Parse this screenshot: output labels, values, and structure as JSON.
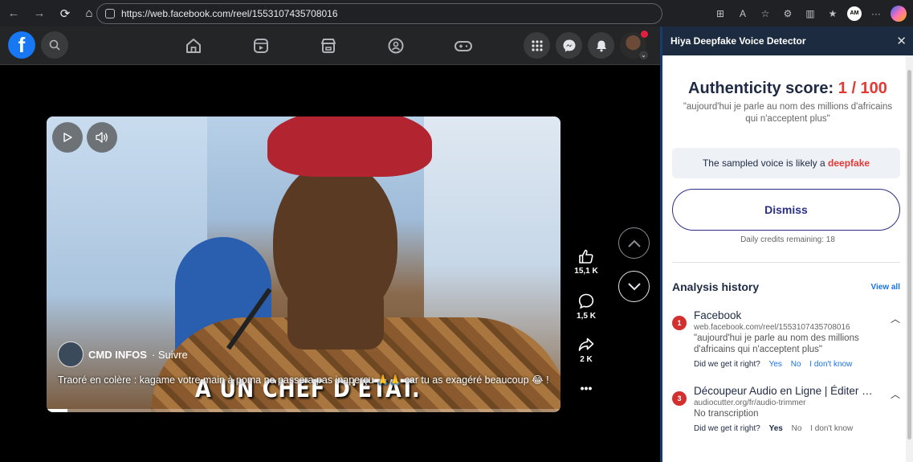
{
  "browser": {
    "url": "https://web.facebook.com/reel/1553107435708016",
    "profile_initials": "AM"
  },
  "facebook": {
    "logo": "f",
    "video": {
      "author": "CMD INFOS",
      "follow_label": "· Suivre",
      "caption": "Traoré en colère : kagame votre main à poma ne passera pas inaperçu 🙏🙏 car tu as exagéré beaucoup 😂 !",
      "subtitle": "A UN CHEF D'ETAT.",
      "progress": 0.04
    },
    "actions": {
      "likes": "15,1 K",
      "comments": "1,5 K",
      "shares": "2 K",
      "more": "•••"
    }
  },
  "extension": {
    "title": "Hiya Deepfake Voice Detector",
    "score_label": "Authenticity score:",
    "score_value": "1 / 100",
    "quote": "\"aujourd'hui je parle au nom des millions d'africains qui n'acceptent plus\"",
    "verdict_prefix": "The sampled voice is likely a",
    "verdict_word": "deepfake",
    "dismiss_label": "Dismiss",
    "credits": "Daily credits remaining: 18",
    "history_title": "Analysis history",
    "view_all": "View all",
    "history": [
      {
        "num": "1",
        "title": "Facebook",
        "url": "web.facebook.com/reel/1553107435708016",
        "text": "\"aujourd'hui je parle au nom des millions d'africains qui n'acceptent plus\"",
        "question": "Did we get it right?",
        "yes": "Yes",
        "no": "No",
        "dunno": "I don't know"
      },
      {
        "num": "3",
        "title": "Découpeur Audio en Ligne | Éditer et Couper",
        "url": "audiocutter.org/fr/audio-trimmer",
        "text": "No transcription",
        "question": "Did we get it right?",
        "yes": "Yes",
        "no": "No",
        "dunno": "I don't know"
      }
    ]
  }
}
